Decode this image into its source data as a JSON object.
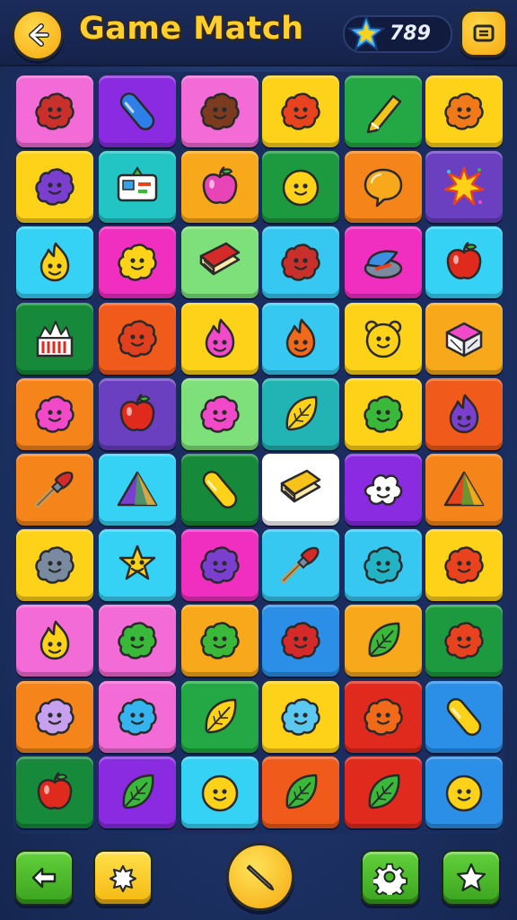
{
  "header": {
    "title": "Game Match",
    "score": "789",
    "back_icon": "back-arrow-icon",
    "menu_icon": "menu-icon",
    "score_icon": "star-gem-icon"
  },
  "board": {
    "rows": [
      [
        {
          "bg": "#f26bd6",
          "icon": "blob",
          "c": "#c9302c"
        },
        {
          "bg": "#8a2be2",
          "icon": "capsule",
          "c": "#2f7fe8"
        },
        {
          "bg": "#f26bd6",
          "icon": "blob",
          "c": "#7a3b1e"
        },
        {
          "bg": "#ffd21a",
          "icon": "blob",
          "c": "#e8421e"
        },
        {
          "bg": "#23a845",
          "icon": "pen",
          "c": "#f0c419"
        },
        {
          "bg": "#ffd21a",
          "icon": "blob",
          "c": "#f07a1a"
        }
      ],
      [
        {
          "bg": "#ffd21a",
          "icon": "blob",
          "c": "#7b3fd0"
        },
        {
          "bg": "#22c4c4",
          "icon": "card",
          "c": "#ffffff"
        },
        {
          "bg": "#f7a81b",
          "icon": "apple",
          "c": "#e844b8"
        },
        {
          "bg": "#1d9a3f",
          "icon": "face",
          "c": "#ffd21a"
        },
        {
          "bg": "#f5841a",
          "icon": "bubble",
          "c": "#f7a81b"
        },
        {
          "bg": "#6a3fc0",
          "icon": "burst",
          "c": "#ffd21a"
        }
      ],
      [
        {
          "bg": "#36d2f5",
          "icon": "flame",
          "c": "#ffd21a"
        },
        {
          "bg": "#f02fc0",
          "icon": "blob",
          "c": "#ffd21a"
        },
        {
          "bg": "#7de07a",
          "icon": "book",
          "c": "#d42a2a"
        },
        {
          "bg": "#36c8f0",
          "icon": "blob",
          "c": "#c9302c"
        },
        {
          "bg": "#f02fc0",
          "icon": "cap",
          "c": "#3a8fe0"
        },
        {
          "bg": "#36d2f5",
          "icon": "apple",
          "c": "#e02a1e"
        }
      ],
      [
        {
          "bg": "#168a3a",
          "icon": "chart",
          "c": "#ffffff"
        },
        {
          "bg": "#f05a1a",
          "icon": "blob",
          "c": "#e0401e"
        },
        {
          "bg": "#ffd21a",
          "icon": "flame",
          "c": "#f04ac8"
        },
        {
          "bg": "#36c8f0",
          "icon": "flame",
          "c": "#f06a1a"
        },
        {
          "bg": "#ffd21a",
          "icon": "bear",
          "c": "#ffd21a"
        },
        {
          "bg": "#f7a81b",
          "icon": "box",
          "c": "#f04ac8"
        }
      ],
      [
        {
          "bg": "#f5841a",
          "icon": "blob",
          "c": "#f04ac8"
        },
        {
          "bg": "#6a3fc0",
          "icon": "apple",
          "c": "#e02a1e"
        },
        {
          "bg": "#7de07a",
          "icon": "blob",
          "c": "#f04ac8"
        },
        {
          "bg": "#22b4b4",
          "icon": "leaf",
          "c": "#ffd21a"
        },
        {
          "bg": "#ffd21a",
          "icon": "blob",
          "c": "#3ab83a"
        },
        {
          "bg": "#f05a1a",
          "icon": "flame",
          "c": "#7b3fd0"
        }
      ],
      [
        {
          "bg": "#f5841a",
          "icon": "brush",
          "c": "#d42a2a"
        },
        {
          "bg": "#36d2f5",
          "icon": "triangle",
          "c": "#7b3fd0"
        },
        {
          "bg": "#168a3a",
          "icon": "capsule",
          "c": "#ffd21a"
        },
        {
          "bg": "#ffffff",
          "icon": "book",
          "c": "#f7c21a"
        },
        {
          "bg": "#8a2be2",
          "icon": "cloud",
          "c": "#ffffff"
        },
        {
          "bg": "#f5841a",
          "icon": "triangle",
          "c": "#e8421e"
        }
      ],
      [
        {
          "bg": "#ffd21a",
          "icon": "blob",
          "c": "#7a8aa0"
        },
        {
          "bg": "#36d2f5",
          "icon": "star",
          "c": "#ffd21a"
        },
        {
          "bg": "#f02fc0",
          "icon": "blob",
          "c": "#7b3fd0"
        },
        {
          "bg": "#36c8f0",
          "icon": "brush",
          "c": "#d42a2a"
        },
        {
          "bg": "#36c8f0",
          "icon": "blob",
          "c": "#22b4c4"
        },
        {
          "bg": "#ffd21a",
          "icon": "blob",
          "c": "#e8421e"
        }
      ],
      [
        {
          "bg": "#f26bd6",
          "icon": "flame",
          "c": "#ffd21a"
        },
        {
          "bg": "#f26bd6",
          "icon": "blob",
          "c": "#3ab83a"
        },
        {
          "bg": "#f7a81b",
          "icon": "blob",
          "c": "#3ab83a"
        },
        {
          "bg": "#2b8fe8",
          "icon": "blob",
          "c": "#d42a2a"
        },
        {
          "bg": "#f7a81b",
          "icon": "leaf",
          "c": "#3ab83a"
        },
        {
          "bg": "#1d9a3f",
          "icon": "blob",
          "c": "#e8421e"
        }
      ],
      [
        {
          "bg": "#f5841a",
          "icon": "blob",
          "c": "#c8a0f0"
        },
        {
          "bg": "#f26bd6",
          "icon": "blob",
          "c": "#36b4f0"
        },
        {
          "bg": "#23a845",
          "icon": "leaf",
          "c": "#ffd21a"
        },
        {
          "bg": "#ffd21a",
          "icon": "blob",
          "c": "#5ac8f0"
        },
        {
          "bg": "#e02a1e",
          "icon": "blob",
          "c": "#f06a1a"
        },
        {
          "bg": "#2b8fe8",
          "icon": "capsule",
          "c": "#ffd21a"
        }
      ],
      [
        {
          "bg": "#168a3a",
          "icon": "apple",
          "c": "#e02a1e"
        },
        {
          "bg": "#8a2be2",
          "icon": "leaf",
          "c": "#3ab83a"
        },
        {
          "bg": "#36d2f5",
          "icon": "face",
          "c": "#ffd21a"
        },
        {
          "bg": "#f05a1a",
          "icon": "leaf",
          "c": "#3ab83a"
        },
        {
          "bg": "#e02a1e",
          "icon": "leaf",
          "c": "#3ab83a"
        },
        {
          "bg": "#2b8fe8",
          "icon": "face",
          "c": "#ffd21a"
        }
      ]
    ]
  },
  "bottom": {
    "left_icon": "back-arrow-icon",
    "hint_icon": "gear-flower-icon",
    "center_icon": "pencil-icon",
    "settings_icon": "settings-gear-icon",
    "favorite_icon": "star-icon"
  },
  "colors": {
    "accent": "#ffcf2e",
    "background": "#1d3266",
    "green_button": "#4cbb28",
    "yellow_button": "#f7c21a"
  }
}
